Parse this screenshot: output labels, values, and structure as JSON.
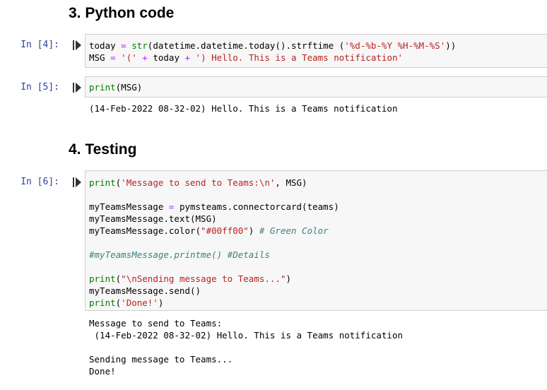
{
  "headings": {
    "python_code": "3. Python code",
    "testing": "4. Testing"
  },
  "cells": [
    {
      "prompt": "In [4]:",
      "code": [
        [
          [
            "plain",
            "today "
          ],
          [
            "op",
            "="
          ],
          [
            "plain",
            " "
          ],
          [
            "bi",
            "str"
          ],
          [
            "plain",
            "(datetime.datetime.today().strftime ("
          ],
          [
            "str",
            "'%d-%b-%Y %H-%M-%S'"
          ],
          [
            "plain",
            "))"
          ]
        ],
        [
          [
            "plain",
            "MSG "
          ],
          [
            "op",
            "="
          ],
          [
            "plain",
            " "
          ],
          [
            "str",
            "'('"
          ],
          [
            "plain",
            " "
          ],
          [
            "op",
            "+"
          ],
          [
            "plain",
            " today "
          ],
          [
            "op",
            "+"
          ],
          [
            "plain",
            " "
          ],
          [
            "str",
            "') Hello. This is a Teams notification'"
          ]
        ]
      ],
      "output": []
    },
    {
      "prompt": "In [5]:",
      "code": [
        [
          [
            "bi",
            "print"
          ],
          [
            "plain",
            "(MSG)"
          ]
        ]
      ],
      "output": [
        "(14-Feb-2022 08-32-02) Hello. This is a Teams notification"
      ]
    },
    {
      "prompt": "In [6]:",
      "code": [
        [
          [
            "bi",
            "print"
          ],
          [
            "plain",
            "("
          ],
          [
            "str",
            "'Message to send to Teams:\\n'"
          ],
          [
            "plain",
            ", MSG)"
          ]
        ],
        [],
        [
          [
            "plain",
            "myTeamsMessage "
          ],
          [
            "op",
            "="
          ],
          [
            "plain",
            " pymsteams.connectorcard(teams)"
          ]
        ],
        [
          [
            "plain",
            "myTeamsMessage.text(MSG)"
          ]
        ],
        [
          [
            "plain",
            "myTeamsMessage.color("
          ],
          [
            "str",
            "\"#00ff00\""
          ],
          [
            "plain",
            ") "
          ],
          [
            "cm",
            "# Green Color"
          ]
        ],
        [],
        [
          [
            "cm",
            "#myTeamsMessage.printme() #Details"
          ]
        ],
        [],
        [
          [
            "bi",
            "print"
          ],
          [
            "plain",
            "("
          ],
          [
            "str",
            "\"\\nSending message to Teams...\""
          ],
          [
            "plain",
            ")"
          ]
        ],
        [
          [
            "plain",
            "myTeamsMessage.send()"
          ]
        ],
        [
          [
            "bi",
            "print"
          ],
          [
            "plain",
            "("
          ],
          [
            "str",
            "'Done!'"
          ],
          [
            "plain",
            ")"
          ]
        ]
      ],
      "output": [
        "Message to send to Teams:",
        " (14-Feb-2022 08-32-02) Hello. This is a Teams notification",
        "",
        "Sending message to Teams...",
        "Done!"
      ]
    }
  ],
  "icons": {
    "run": "run-cell-icon"
  },
  "colors": {
    "prompt": "#303f9f",
    "cell_bg": "#f7f7f7",
    "cell_border": "#cfcfcf",
    "keyword_op": "#aa22ff",
    "builtin": "#008000",
    "string": "#ba2121",
    "comment": "#408080"
  }
}
